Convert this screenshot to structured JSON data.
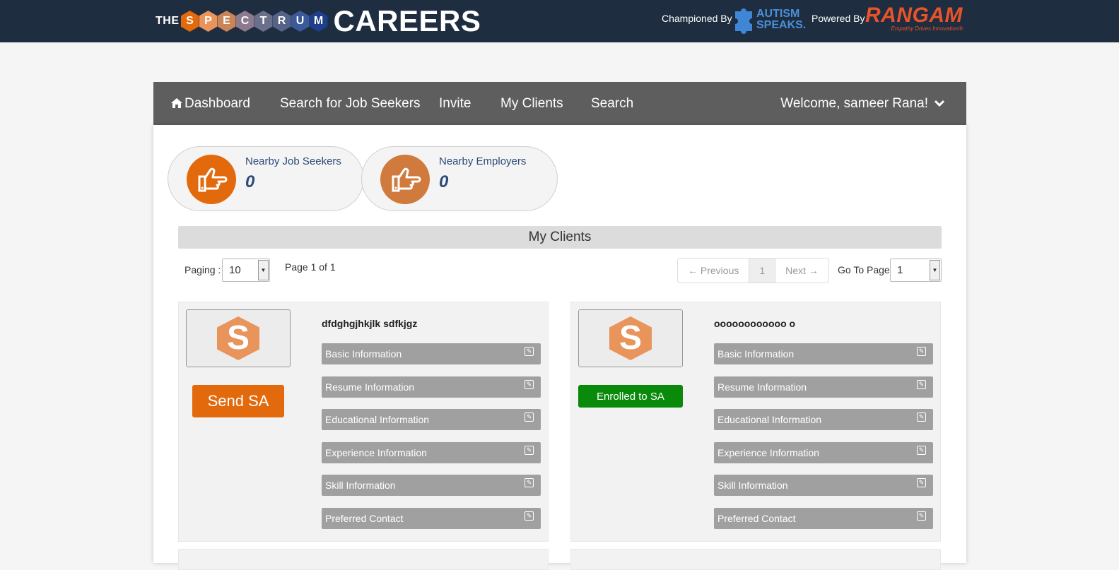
{
  "header": {
    "brand_the": "THE",
    "brand_letters": [
      "S",
      "P",
      "E",
      "C",
      "T",
      "R",
      "U",
      "M"
    ],
    "brand_colors": [
      "#e36a0c",
      "#e8945a",
      "#c98458",
      "#8c7b8e",
      "#6b6f8a",
      "#566386",
      "#3a5a9a",
      "#1e3f8a"
    ],
    "brand_careers": "CAREERS",
    "championed_by": "Championed By",
    "autism_line1": "AUTISM",
    "autism_line2": "SPEAKS.",
    "powered_by": "Powered By",
    "rangam": "RANGAM",
    "rangam_tagline": "Empathy Drives Innovation®"
  },
  "nav": {
    "dashboard": "Dashboard",
    "search_job_seekers": "Search for Job Seekers",
    "invite": "Invite",
    "my_clients": "My Clients",
    "search": "Search",
    "welcome": "Welcome, sameer Rana!"
  },
  "stats": {
    "job_seekers": {
      "label": "Nearby Job Seekers",
      "count": "0",
      "color": "#e36a0c"
    },
    "employers": {
      "label": "Nearby Employers",
      "count": "0",
      "color": "#d07a3e"
    }
  },
  "section": {
    "title": "My Clients",
    "paging_label": "Paging :",
    "paging_value": "10",
    "page_info": "Page 1 of 1",
    "prev": "← Previous",
    "current_page": "1",
    "next": "Next →",
    "goto_label": "Go To Page:",
    "goto_value": "1"
  },
  "clients": [
    {
      "name": "dfdghgjhkjlk sdfkjgz",
      "action": "Send SA",
      "rows": [
        "Basic Information",
        "Resume Information",
        "Educational Information",
        "Experience Information",
        "Skill Information",
        "Preferred Contact"
      ]
    },
    {
      "name": "oooooooooooo o",
      "action": "Enrolled to SA",
      "rows": [
        "Basic Information",
        "Resume Information",
        "Educational Information",
        "Experience Information",
        "Skill Information",
        "Preferred Contact"
      ]
    }
  ],
  "avatar_letter": "S"
}
